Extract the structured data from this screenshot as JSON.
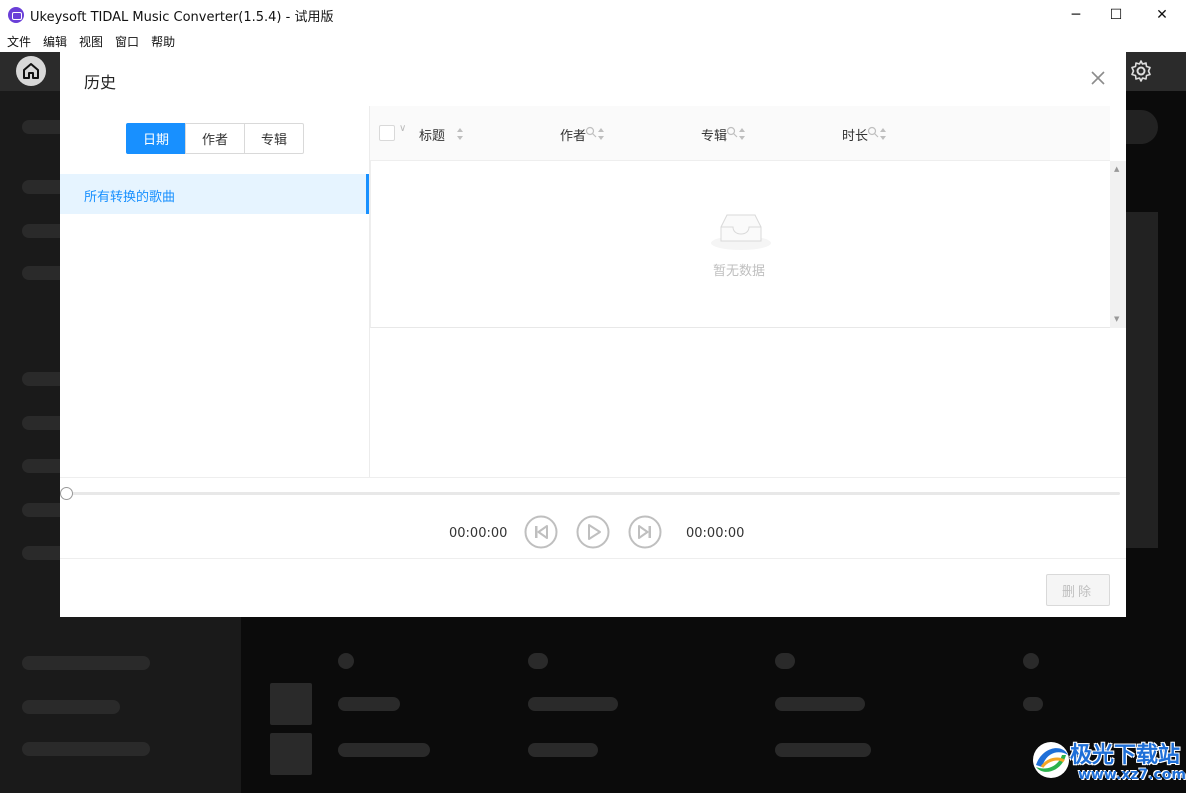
{
  "window": {
    "title": "Ukeysoft TIDAL Music Converter(1.5.4) - 试用版",
    "minimize": "─",
    "maximize": "☐",
    "close": "✕"
  },
  "menu": [
    "文件",
    "编辑",
    "视图",
    "窗口",
    "帮助"
  ],
  "dialog": {
    "title": "历史",
    "tabs": [
      {
        "label": "日期",
        "active": true
      },
      {
        "label": "作者",
        "active": false
      },
      {
        "label": "专辑",
        "active": false
      }
    ],
    "nav_all_songs": "所有转换的歌曲",
    "columns": [
      "标题",
      "作者",
      "专辑",
      "时长"
    ],
    "empty_text": "暂无数据",
    "player": {
      "current_time": "00:00:00",
      "total_time": "00:00:00",
      "progress": 0
    },
    "delete_label": "删除"
  },
  "watermark": {
    "brand": "极光下载站",
    "url": "www.xz7.com"
  },
  "colors": {
    "accent": "#1890ff",
    "selected_bg": "#e6f4ff",
    "app_dark": "#0b0b0b"
  }
}
